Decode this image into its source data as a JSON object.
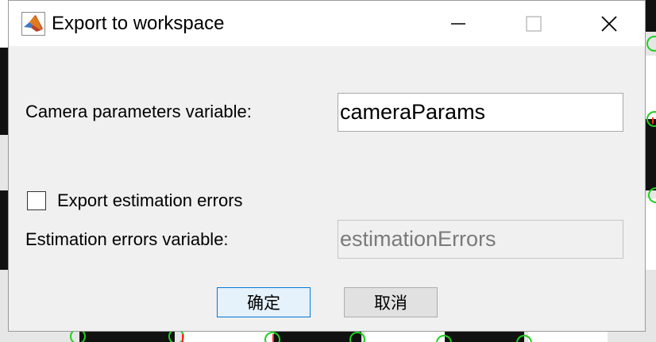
{
  "window": {
    "title": "Export to workspace",
    "app_icon": "matlab-icon",
    "controls": [
      "minimize-icon",
      "maximize-icon",
      "close-icon"
    ]
  },
  "form": {
    "camera_label": "Camera parameters variable:",
    "camera_value": "cameraParams",
    "export_errors_label": "Export estimation errors",
    "export_errors_checked": false,
    "errors_label": "Estimation errors variable:",
    "errors_value": "estimationErrors",
    "errors_enabled": false
  },
  "buttons": {
    "ok_label": "确定",
    "cancel_label": "取消"
  },
  "colors": {
    "accent": "#0078d7",
    "dialog_bg": "#f0f0f0",
    "disabled_text": "#7a7a7a",
    "marker": "#1fd11f"
  }
}
